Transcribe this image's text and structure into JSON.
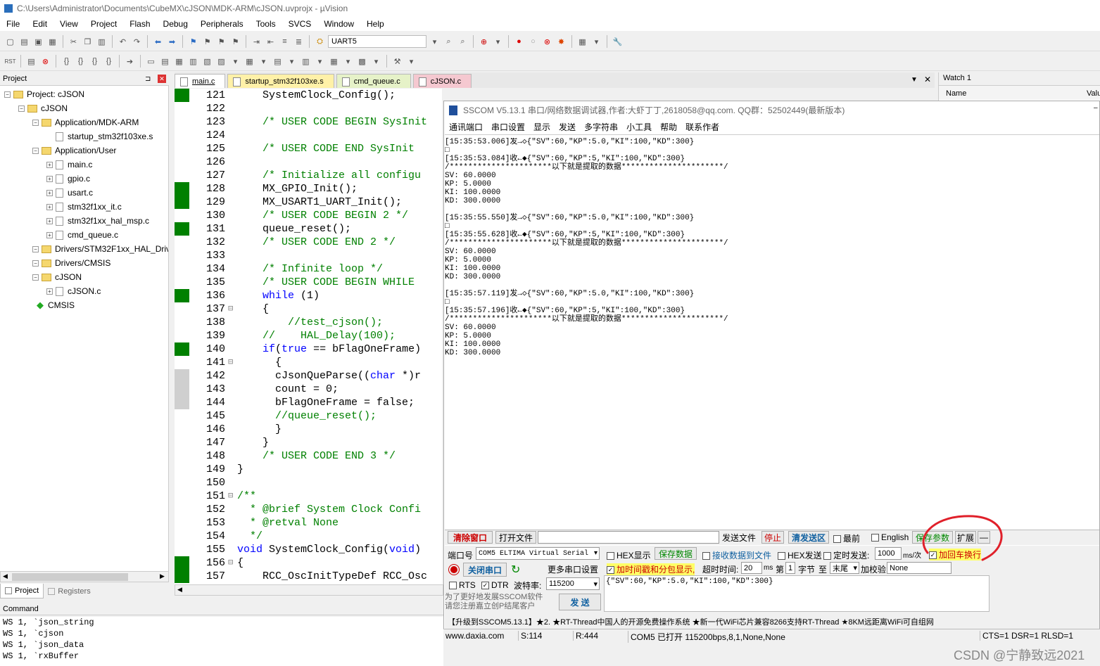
{
  "window": {
    "title": "C:\\Users\\Administrator\\Documents\\CubeMX\\cJSON\\MDK-ARM\\cJSON.uvprojx - µVision"
  },
  "menu": [
    "File",
    "Edit",
    "View",
    "Project",
    "Flash",
    "Debug",
    "Peripherals",
    "Tools",
    "SVCS",
    "Window",
    "Help"
  ],
  "toolbar": {
    "target": "UART5"
  },
  "project_panel": {
    "title": "Project",
    "tabs": [
      "Project",
      "Registers"
    ],
    "tree": [
      {
        "label": "Project: cJSON",
        "depth": 0,
        "kind": "root"
      },
      {
        "label": "cJSON",
        "depth": 1,
        "kind": "target"
      },
      {
        "label": "Application/MDK-ARM",
        "depth": 2,
        "kind": "folder"
      },
      {
        "label": "startup_stm32f103xe.s",
        "depth": 3,
        "kind": "file"
      },
      {
        "label": "Application/User",
        "depth": 2,
        "kind": "folder"
      },
      {
        "label": "main.c",
        "depth": 3,
        "kind": "file"
      },
      {
        "label": "gpio.c",
        "depth": 3,
        "kind": "file"
      },
      {
        "label": "usart.c",
        "depth": 3,
        "kind": "file"
      },
      {
        "label": "stm32f1xx_it.c",
        "depth": 3,
        "kind": "file"
      },
      {
        "label": "stm32f1xx_hal_msp.c",
        "depth": 3,
        "kind": "file"
      },
      {
        "label": "cmd_queue.c",
        "depth": 3,
        "kind": "file"
      },
      {
        "label": "Drivers/STM32F1xx_HAL_Driv",
        "depth": 2,
        "kind": "folder"
      },
      {
        "label": "Drivers/CMSIS",
        "depth": 2,
        "kind": "folder"
      },
      {
        "label": "cJSON",
        "depth": 2,
        "kind": "folder"
      },
      {
        "label": "cJSON.c",
        "depth": 3,
        "kind": "file"
      },
      {
        "label": "CMSIS",
        "depth": 2,
        "kind": "diamond"
      }
    ]
  },
  "editor_tabs": [
    {
      "label": "main.c",
      "color": "#ffffff"
    },
    {
      "label": "startup_stm32f103xe.s",
      "color": "#fff1a8"
    },
    {
      "label": "cmd_queue.c",
      "color": "#e6f2c8"
    },
    {
      "label": "cJSON.c",
      "color": "#f5c8d0"
    }
  ],
  "code": [
    {
      "n": "121",
      "t": "    SystemClock_Config();",
      "bp": "g",
      "c": ""
    },
    {
      "n": "122",
      "t": "",
      "bp": "",
      "c": ""
    },
    {
      "n": "123",
      "t": "    /* USER CODE BEGIN SysInit",
      "bp": "",
      "c": "cm"
    },
    {
      "n": "124",
      "t": "",
      "bp": "",
      "c": ""
    },
    {
      "n": "125",
      "t": "    /* USER CODE END SysInit ",
      "bp": "",
      "c": "cm"
    },
    {
      "n": "126",
      "t": "",
      "bp": "",
      "c": ""
    },
    {
      "n": "127",
      "t": "    /* Initialize all configu",
      "bp": "",
      "c": "cm"
    },
    {
      "n": "128",
      "t": "    MX_GPIO_Init();",
      "bp": "g",
      "c": ""
    },
    {
      "n": "129",
      "t": "    MX_USART1_UART_Init();",
      "bp": "g",
      "c": ""
    },
    {
      "n": "130",
      "t": "    /* USER CODE BEGIN 2 */",
      "bp": "",
      "c": "cm"
    },
    {
      "n": "131",
      "t": "    queue_reset();",
      "bp": "g",
      "c": ""
    },
    {
      "n": "132",
      "t": "    /* USER CODE END 2 */",
      "bp": "",
      "c": "cm"
    },
    {
      "n": "133",
      "t": "",
      "bp": "",
      "c": ""
    },
    {
      "n": "134",
      "t": "    /* Infinite loop */",
      "bp": "",
      "c": "cm"
    },
    {
      "n": "135",
      "t": "    /* USER CODE BEGIN WHILE ",
      "bp": "",
      "c": "cm"
    },
    {
      "n": "136",
      "t": "    while (1)",
      "bp": "g",
      "c": "kwl"
    },
    {
      "n": "137",
      "t": "    {",
      "bp": "",
      "c": "",
      "f": "⊟"
    },
    {
      "n": "138",
      "t": "        //test_cjson();",
      "bp": "",
      "c": "cm"
    },
    {
      "n": "139",
      "t": "    //    HAL_Delay(100);",
      "bp": "",
      "c": "cm"
    },
    {
      "n": "140",
      "t": "    if(true == bFlagOneFrame)",
      "bp": "g",
      "c": "iff"
    },
    {
      "n": "141",
      "t": "      {",
      "bp": "",
      "c": "",
      "f": "⊟"
    },
    {
      "n": "142",
      "t": "      cJsonQueParse((char *)r",
      "bp": "x",
      "c": "chr"
    },
    {
      "n": "143",
      "t": "      count = 0;",
      "bp": "x",
      "c": ""
    },
    {
      "n": "144",
      "t": "      bFlagOneFrame = false;",
      "bp": "x",
      "c": ""
    },
    {
      "n": "145",
      "t": "      //queue_reset();",
      "bp": "",
      "c": "cm"
    },
    {
      "n": "146",
      "t": "      }",
      "bp": "",
      "c": ""
    },
    {
      "n": "147",
      "t": "    }",
      "bp": "",
      "c": ""
    },
    {
      "n": "148",
      "t": "    /* USER CODE END 3 */",
      "bp": "",
      "c": "cm"
    },
    {
      "n": "149",
      "t": "}",
      "bp": "",
      "c": ""
    },
    {
      "n": "150",
      "t": "",
      "bp": "",
      "c": ""
    },
    {
      "n": "151",
      "t": "/**",
      "bp": "",
      "c": "cm",
      "f": "⊟"
    },
    {
      "n": "152",
      "t": "  * @brief System Clock Confi",
      "bp": "",
      "c": "cm"
    },
    {
      "n": "153",
      "t": "  * @retval None",
      "bp": "",
      "c": "cm"
    },
    {
      "n": "154",
      "t": "  */",
      "bp": "",
      "c": "cm"
    },
    {
      "n": "155",
      "t": "void SystemClock_Config(void)",
      "bp": "",
      "c": "vd"
    },
    {
      "n": "156",
      "t": "{",
      "bp": "g",
      "c": "",
      "f": "⊟"
    },
    {
      "n": "157",
      "t": "    RCC_OscInitTypeDef RCC_Osc",
      "bp": "g",
      "c": ""
    }
  ],
  "command": {
    "title": "Command",
    "lines": [
      "WS 1, `json_string",
      "WS 1, `cjson",
      "WS 1, `json_data",
      "WS 1, `rxBuffer"
    ]
  },
  "watch": {
    "title": "Watch 1",
    "col_name": "Name",
    "col_value": "Valu"
  },
  "sscom": {
    "title": "SSCOM V5.13.1 串口/网络数据调试器,作者:大虾丁丁,2618058@qq.com. QQ群：52502449(最新版本)",
    "menu": [
      "通讯端口",
      "串口设置",
      "显示",
      "发送",
      "多字符串",
      "小工具",
      "帮助",
      "联系作者"
    ],
    "receive": [
      "[15:35:53.006]发→◇{\"SV\":60,\"KP\":5.0,\"KI\":100,\"KD\":300}",
      "□",
      "[15:35:53.084]收←◆{\"SV\":60,\"KP\":5,\"KI\":100,\"KD\":300}",
      "/**********************以下就是提取的数据**********************/",
      "SV: 60.0000",
      "KP: 5.0000",
      "KI: 100.0000",
      "KD: 300.0000",
      "",
      "[15:35:55.550]发→◇{\"SV\":60,\"KP\":5.0,\"KI\":100,\"KD\":300}",
      "□",
      "[15:35:55.628]收←◆{\"SV\":60,\"KP\":5,\"KI\":100,\"KD\":300}",
      "/**********************以下就是提取的数据**********************/",
      "SV: 60.0000",
      "KP: 5.0000",
      "KI: 100.0000",
      "KD: 300.0000",
      "",
      "[15:35:57.119]发→◇{\"SV\":60,\"KP\":5.0,\"KI\":100,\"KD\":300}",
      "□",
      "[15:35:57.196]收←◆{\"SV\":60,\"KP\":5,\"KI\":100,\"KD\":300}",
      "/**********************以下就是提取的数据**********************/",
      "SV: 60.0000",
      "KP: 5.0000",
      "KI: 100.0000",
      "KD: 300.0000"
    ],
    "clear_window": "清除窗口",
    "open_file": "打开文件",
    "send_file": "发送文件",
    "stop": "停止",
    "clear_send": "清发送区",
    "topmost": "最前",
    "english": "English",
    "save_params": "保存参数",
    "expand": "扩展",
    "minus": "—",
    "port_label": "端口号",
    "port_value": "COM5 ELTIMA Virtual Serial",
    "hex_display": "HEX显示",
    "save_data": "保存数据",
    "recv_to_file": "接收数据到文件",
    "hex_send": "HEX发送",
    "timed_send": "定时发送:",
    "interval": "1000",
    "interval_unit": "ms/次",
    "add_crlf": "加回车换行",
    "close_port": "关闭串口",
    "more_settings": "更多串口设置",
    "timestamp": "加时间戳和分包显示,",
    "timeout_label": "超时时间:",
    "timeout_value": "20",
    "ms": "ms",
    "nth": "第",
    "nth_value": "1",
    "byte": "字节",
    "to": "至",
    "end": "末尾",
    "checksum": "加校验",
    "checksum_value": "None",
    "rts": "RTS",
    "dtr": "DTR",
    "baud_label": "波特率:",
    "baud_value": "115200",
    "send_text": "{\"SV\":60,\"KP\":5.0,\"KI\":100,\"KD\":300}",
    "promo": "为了更好地发展SSCOM软件\n请您注册嘉立创P结尾客户",
    "send_btn": "发 送",
    "ticker": "【升级到SSCOM5.13.1】★2. ★RT-Thread中国人的开源免费操作系统 ★新一代WiFi芯片兼容8266支持RT-Thread ★8KM远距离WiFi可自组网",
    "status": {
      "site": "www.daxia.com",
      "s": "S:114",
      "r": "R:444",
      "port": "COM5 已打开  115200bps,8,1,None,None",
      "lines": "CTS=1 DSR=1 RLSD=1"
    }
  },
  "watermark": "CSDN @宁静致远2021",
  "colors": {
    "breakpoint": "#008000",
    "exec": "#cfcfcf",
    "annotation": "#e0202a",
    "highlight": "#ffff66"
  }
}
